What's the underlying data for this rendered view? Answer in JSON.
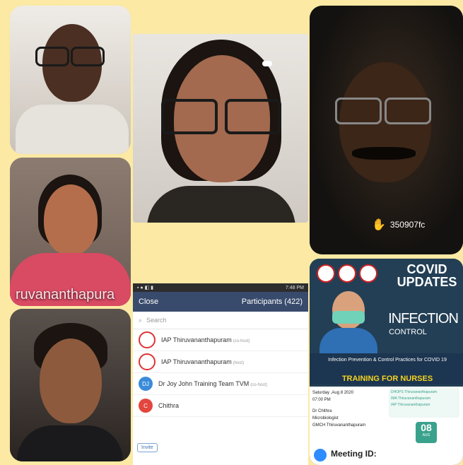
{
  "tiles": {
    "top_center": {
      "status_icon": "cloud-icon"
    },
    "right_top": {
      "raise_hand_icon": "hand-icon",
      "participant_id": "350907fc"
    },
    "left_middle": {
      "name_overlay": "ruvananthapura"
    }
  },
  "participants_panel": {
    "status_time": "7:48 PM",
    "close_label": "Close",
    "title": "Participants (422)",
    "search_placeholder": "Search",
    "rows": [
      {
        "name": "IAP Thiruvananthapuram",
        "sub": "(co-host)",
        "avatar": "iap-logo"
      },
      {
        "name": "IAP Thiruvananthapuram",
        "sub": "(host)",
        "avatar": "iap-logo"
      },
      {
        "name": "Dr Joy John Training Team TVM",
        "sub": "(co-host)",
        "avatar_initials": "DJ"
      },
      {
        "name": "Chithra",
        "sub": "",
        "avatar_initials": "C"
      }
    ],
    "invite_label": "Invite"
  },
  "poster": {
    "heading": "COVID UPDATES",
    "topic": "INFECTION",
    "topic_sub": "CONTROL",
    "subtitle": "Infection Prevention & Control Practices for COVID 19",
    "banner": "TRAINING FOR NURSES",
    "date_line": "Saturday ,Aug 8 2020",
    "time_line": "07:00 PM",
    "speaker": "Dr Chithra",
    "speaker_role": "Microbiologist",
    "speaker_org": "GMCH Thiruvananthapuram",
    "org_lines": [
      "DHOPS Thiruvananthapuram",
      "IMA Thiruvananthapuram",
      "IAP Thiruvananthapuram"
    ],
    "day_badge": "08",
    "month_badge": "AUG",
    "meeting_label": "Meeting ID:",
    "colors": {
      "teal": "#1f3e52",
      "yellow": "#f4d21f",
      "green": "#3aa28c"
    }
  }
}
